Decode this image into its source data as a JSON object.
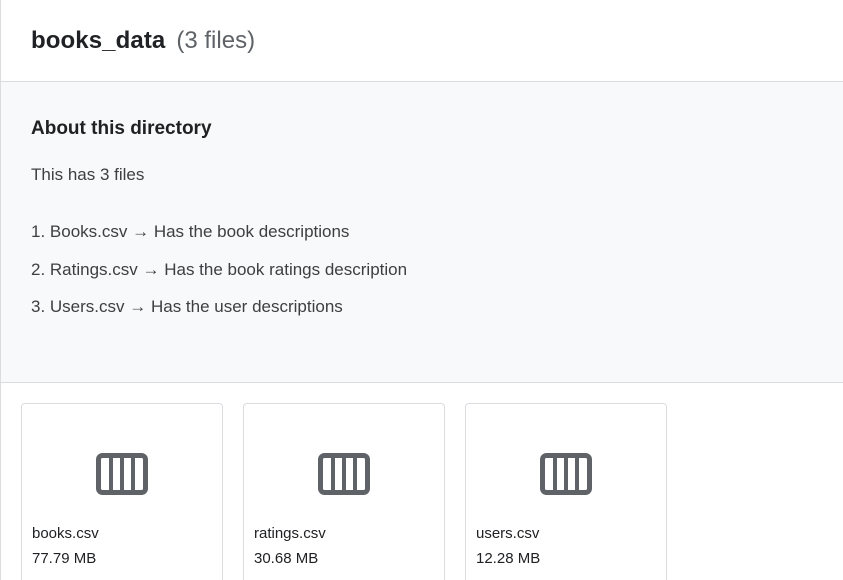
{
  "header": {
    "title": "books_data",
    "count": "(3 files)"
  },
  "about": {
    "heading": "About this directory",
    "intro": "This has 3 files",
    "items": [
      "1. Books.csv → Has the book descriptions",
      "2. Ratings.csv → Has the book ratings description",
      "3. Users.csv → Has the user descriptions"
    ]
  },
  "files": [
    {
      "name": "books.csv",
      "size": "77.79 MB",
      "icon": "table-icon"
    },
    {
      "name": "ratings.csv",
      "size": "30.68 MB",
      "icon": "table-icon"
    },
    {
      "name": "users.csv",
      "size": "12.28 MB",
      "icon": "table-icon"
    }
  ],
  "colors": {
    "icon": "#5f6368",
    "border": "#dadce0",
    "about_bg": "#f8f9fa"
  }
}
